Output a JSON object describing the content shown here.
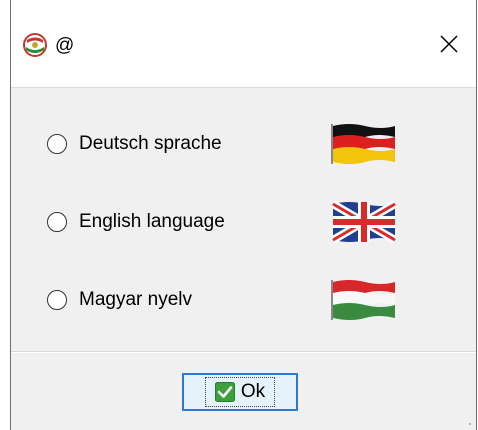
{
  "window": {
    "title": "@",
    "icons": {
      "app": "app-flag-icon",
      "close": "close-icon"
    }
  },
  "options": [
    {
      "label": "Deutsch sprache",
      "flag": "german-flag-icon",
      "selected": false
    },
    {
      "label": "English language",
      "flag": "uk-flag-icon",
      "selected": false
    },
    {
      "label": "Magyar nyelv",
      "flag": "hungarian-flag-icon",
      "selected": false
    }
  ],
  "ok_button": {
    "label": "Ok",
    "icon": "checkmark-icon"
  },
  "colors": {
    "window_bg": "#f0f0f0",
    "titlebar_bg": "#ffffff",
    "button_border": "#2a7ad1",
    "button_bg": "#e5f1fb",
    "check_green": "#3ca03c"
  }
}
